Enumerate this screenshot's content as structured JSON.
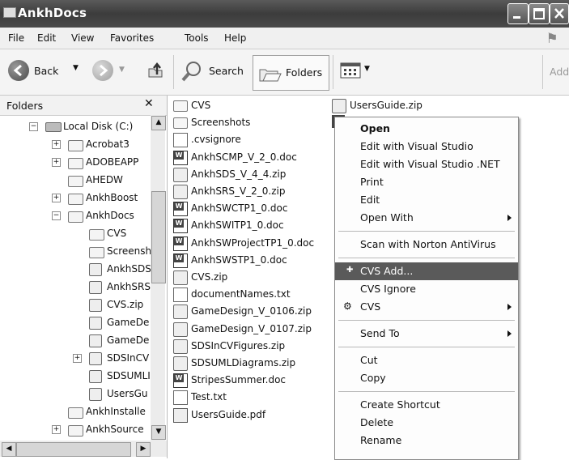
{
  "window": {
    "title": "AnkhDocs"
  },
  "menu": [
    "File",
    "Edit",
    "View",
    "Favorites",
    "Tools",
    "Help"
  ],
  "toolbar": {
    "back": "Back",
    "search": "Search",
    "folders": "Folders",
    "address": "Address"
  },
  "folders_pane": {
    "header": "Folders",
    "close": "✕",
    "tree": [
      {
        "label": "Local Disk (C:)",
        "indent": 0,
        "expander": "minus"
      },
      {
        "label": "Acrobat3",
        "indent": 1,
        "expander": "plus"
      },
      {
        "label": "ADOBEAPP",
        "indent": 1,
        "expander": "plus"
      },
      {
        "label": "AHEDW",
        "indent": 1,
        "expander": "none"
      },
      {
        "label": "AnkhBoost",
        "indent": 1,
        "expander": "plus"
      },
      {
        "label": "AnkhDocs",
        "indent": 1,
        "expander": "minus"
      },
      {
        "label": "CVS",
        "indent": 2,
        "expander": "none"
      },
      {
        "label": "Screensh",
        "indent": 2,
        "expander": "none"
      },
      {
        "label": "AnkhSDS",
        "indent": 2,
        "expander": "none"
      },
      {
        "label": "AnkhSRS",
        "indent": 2,
        "expander": "none"
      },
      {
        "label": "CVS.zip",
        "indent": 2,
        "expander": "none"
      },
      {
        "label": "GameDe",
        "indent": 2,
        "expander": "none"
      },
      {
        "label": "GameDe",
        "indent": 2,
        "expander": "none"
      },
      {
        "label": "SDSInCV",
        "indent": 2,
        "expander": "plus"
      },
      {
        "label": "SDSUMLI",
        "indent": 2,
        "expander": "none"
      },
      {
        "label": "UsersGu",
        "indent": 2,
        "expander": "none"
      },
      {
        "label": "AnkhInstalle",
        "indent": 1,
        "expander": "none"
      },
      {
        "label": "AnkhSource",
        "indent": 1,
        "expander": "plus"
      }
    ]
  },
  "files_col1": [
    {
      "name": "CVS",
      "type": "folder"
    },
    {
      "name": "Screenshots",
      "type": "folder"
    },
    {
      "name": ".cvsignore",
      "type": "txt"
    },
    {
      "name": "AnkhSCMP_V_2_0.doc",
      "type": "doc"
    },
    {
      "name": "AnkhSDS_V_4_4.zip",
      "type": "zip"
    },
    {
      "name": "AnkhSRS_V_2_0.zip",
      "type": "zip"
    },
    {
      "name": "AnkhSWCTP1_0.doc",
      "type": "doc"
    },
    {
      "name": "AnkhSWITP1_0.doc",
      "type": "doc"
    },
    {
      "name": "AnkhSWProjectTP1_0.doc",
      "type": "doc"
    },
    {
      "name": "AnkhSWSTP1_0.doc",
      "type": "doc"
    },
    {
      "name": "CVS.zip",
      "type": "zip"
    },
    {
      "name": "documentNames.txt",
      "type": "txt"
    },
    {
      "name": "GameDesign_V_0106.zip",
      "type": "zip"
    },
    {
      "name": "GameDesign_V_0107.zip",
      "type": "zip"
    },
    {
      "name": "SDSInCVFigures.zip",
      "type": "zip"
    },
    {
      "name": "SDSUMLDiagrams.zip",
      "type": "zip"
    },
    {
      "name": "StripesSummer.doc",
      "type": "doc"
    },
    {
      "name": "Test.txt",
      "type": "txt"
    },
    {
      "name": "UsersGuide.pdf",
      "type": "pdf"
    }
  ],
  "files_col2": [
    {
      "name": "UsersGuide.zip",
      "type": "zip"
    }
  ],
  "context_menu": {
    "items": [
      {
        "label": "Open",
        "bold": true
      },
      {
        "label": "Edit with Visual Studio"
      },
      {
        "label": "Edit with Visual Studio .NET"
      },
      {
        "label": "Print"
      },
      {
        "label": "Edit"
      },
      {
        "label": "Open With",
        "submenu": true
      },
      {
        "sep": true
      },
      {
        "label": "Scan with Norton AntiVirus"
      },
      {
        "sep": true
      },
      {
        "label": "CVS Add...",
        "highlighted": true
      },
      {
        "label": "CVS Ignore"
      },
      {
        "label": "CVS",
        "submenu": true
      },
      {
        "sep": true
      },
      {
        "label": "Send To",
        "submenu": true
      },
      {
        "sep": true
      },
      {
        "label": "Cut"
      },
      {
        "label": "Copy"
      },
      {
        "sep": true
      },
      {
        "label": "Create Shortcut"
      },
      {
        "label": "Delete"
      },
      {
        "label": "Rename"
      }
    ]
  }
}
